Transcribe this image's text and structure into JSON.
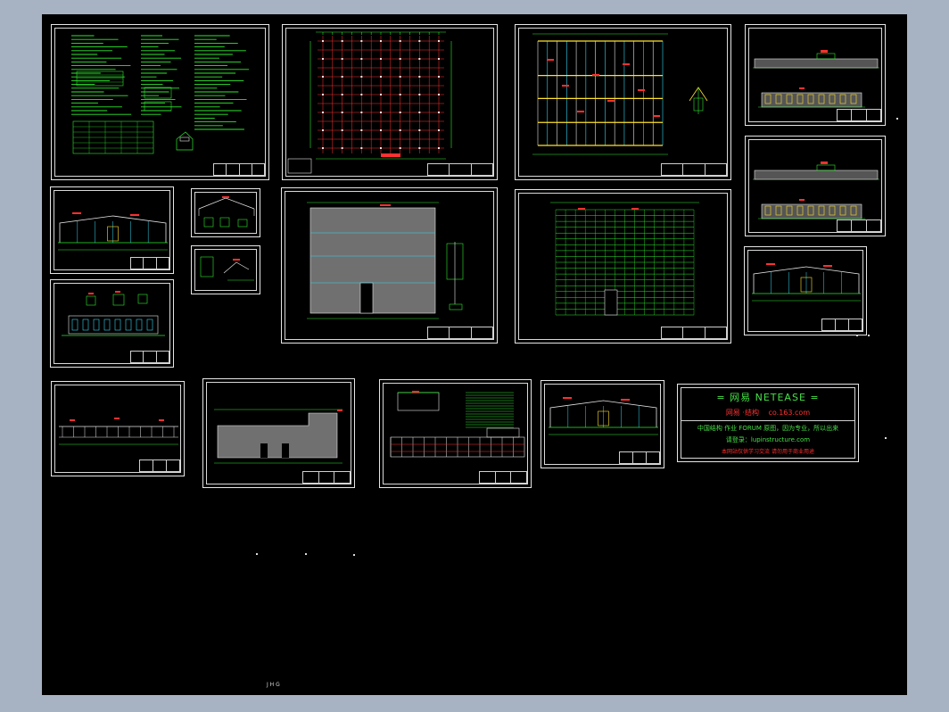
{
  "viewer": {
    "name": "CAD drawing viewer",
    "background": "#a7b3c3",
    "model_space_color": "#000000"
  },
  "colors": {
    "green": "#2ee82e",
    "red": "#ff3030",
    "cyan": "#34d6f0",
    "yellow": "#ffe22e",
    "white": "#e6e6e6",
    "fill_gray": "#707070"
  },
  "sheets": [
    {
      "name": "sheet-design-notes",
      "kind": "notes"
    },
    {
      "name": "sheet-column-layout-plan",
      "kind": "grid-red"
    },
    {
      "name": "sheet-roof-beam-plan",
      "kind": "grid-yellow"
    },
    {
      "name": "sheet-elevation-a",
      "kind": "elevation-wide"
    },
    {
      "name": "sheet-frame-section-1",
      "kind": "frame"
    },
    {
      "name": "sheet-detail-small-1",
      "kind": "detail"
    },
    {
      "name": "sheet-detail-small-2",
      "kind": "detail"
    },
    {
      "name": "sheet-roof-plan",
      "kind": "roof-gray"
    },
    {
      "name": "sheet-purlin-layout",
      "kind": "purlin"
    },
    {
      "name": "sheet-elevation-b",
      "kind": "elevation-wide"
    },
    {
      "name": "sheet-frame-section-2",
      "kind": "frame"
    },
    {
      "name": "sheet-frame-elevation-3",
      "kind": "frame-low"
    },
    {
      "name": "sheet-side-elevation",
      "kind": "side"
    },
    {
      "name": "sheet-floor-plan",
      "kind": "floor-gray"
    },
    {
      "name": "sheet-gable-details",
      "kind": "details-mixed"
    },
    {
      "name": "sheet-frame-section-4",
      "kind": "frame"
    }
  ],
  "stamp": {
    "line1": "= 网易  NETEASE =",
    "line2a": "网易 ·结构",
    "line2b": "co.163.com",
    "line3": "中国结构 作业 FORUM 原图，因为专业，所以出来",
    "line4": "请登录：lupinstructure.com",
    "line5": "本网站仅供学习交流 请勿用于商业用途"
  },
  "cursor_marks": {
    "bottom_text": "J H G"
  }
}
